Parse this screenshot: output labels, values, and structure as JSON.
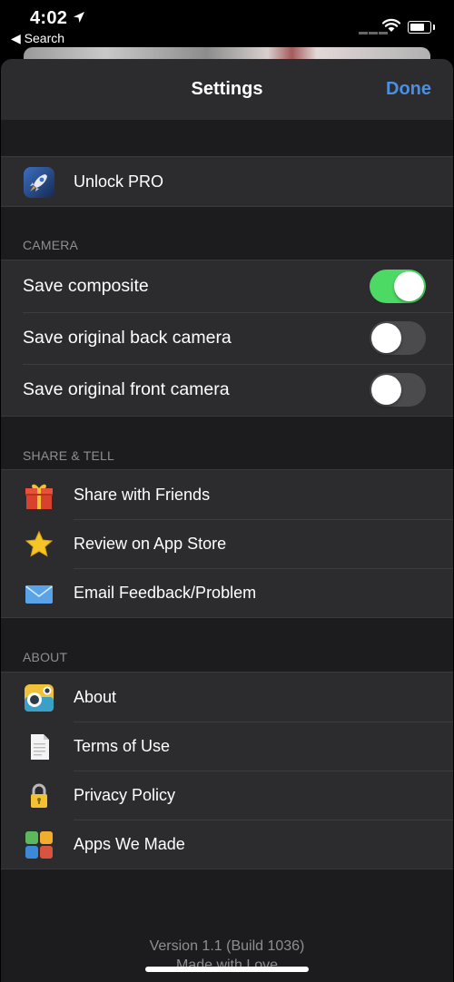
{
  "status": {
    "time": "4:02",
    "back": "Search"
  },
  "nav": {
    "title": "Settings",
    "done": "Done"
  },
  "pro": {
    "label": "Unlock PRO",
    "icon": "rocket-icon"
  },
  "camera": {
    "header": "CAMERA",
    "items": [
      {
        "label": "Save composite",
        "on": true
      },
      {
        "label": "Save original back camera",
        "on": false
      },
      {
        "label": "Save original front camera",
        "on": false
      }
    ]
  },
  "share": {
    "header": "SHARE & TELL",
    "items": [
      {
        "label": "Share with Friends",
        "icon": "gift-icon"
      },
      {
        "label": "Review on App Store",
        "icon": "star-icon"
      },
      {
        "label": "Email Feedback/Problem",
        "icon": "envelope-icon"
      }
    ]
  },
  "about": {
    "header": "ABOUT",
    "items": [
      {
        "label": "About",
        "icon": "camera-app-icon"
      },
      {
        "label": "Terms of Use",
        "icon": "document-icon"
      },
      {
        "label": "Privacy Policy",
        "icon": "lock-icon"
      },
      {
        "label": "Apps We Made",
        "icon": "apps-grid-icon"
      }
    ]
  },
  "footer": {
    "version": "Version 1.1 (Build 1036)",
    "tagline": "Made with Love"
  },
  "colors": {
    "accent": "#4a8fe2",
    "toggle_on": "#4cd964",
    "background": "#1c1c1e",
    "cell": "#2c2c2e"
  }
}
